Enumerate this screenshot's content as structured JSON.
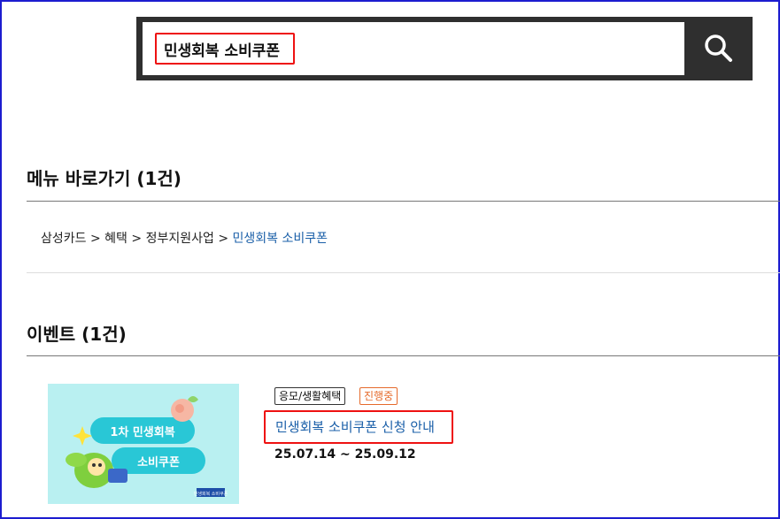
{
  "search": {
    "query": "민생회복 소비쿠폰"
  },
  "menu_section": {
    "title": "메뉴 바로가기 (1건)",
    "breadcrumb": [
      "삼성카드",
      "혜택",
      "정부지원사업",
      "민생회복 소비쿠폰"
    ],
    "separator": ">"
  },
  "event_section": {
    "title": "이벤트 (1건)",
    "event": {
      "category_tag": "응모/생활혜택",
      "status_tag": "진행중",
      "title": "민생회복 소비쿠폰 신청 안내",
      "date": "25.07.14 ~ 25.09.12",
      "thumbnail": {
        "line1": "1차 민생회복",
        "line2": "소비쿠폰",
        "logo_text": "민생회복 소비쿠폰"
      }
    }
  },
  "colors": {
    "frame": "#1c1ccf",
    "search_bar": "#2f2f2f",
    "highlight": "#ee1111",
    "link": "#1a5fa8",
    "status": "#e56a2b"
  }
}
